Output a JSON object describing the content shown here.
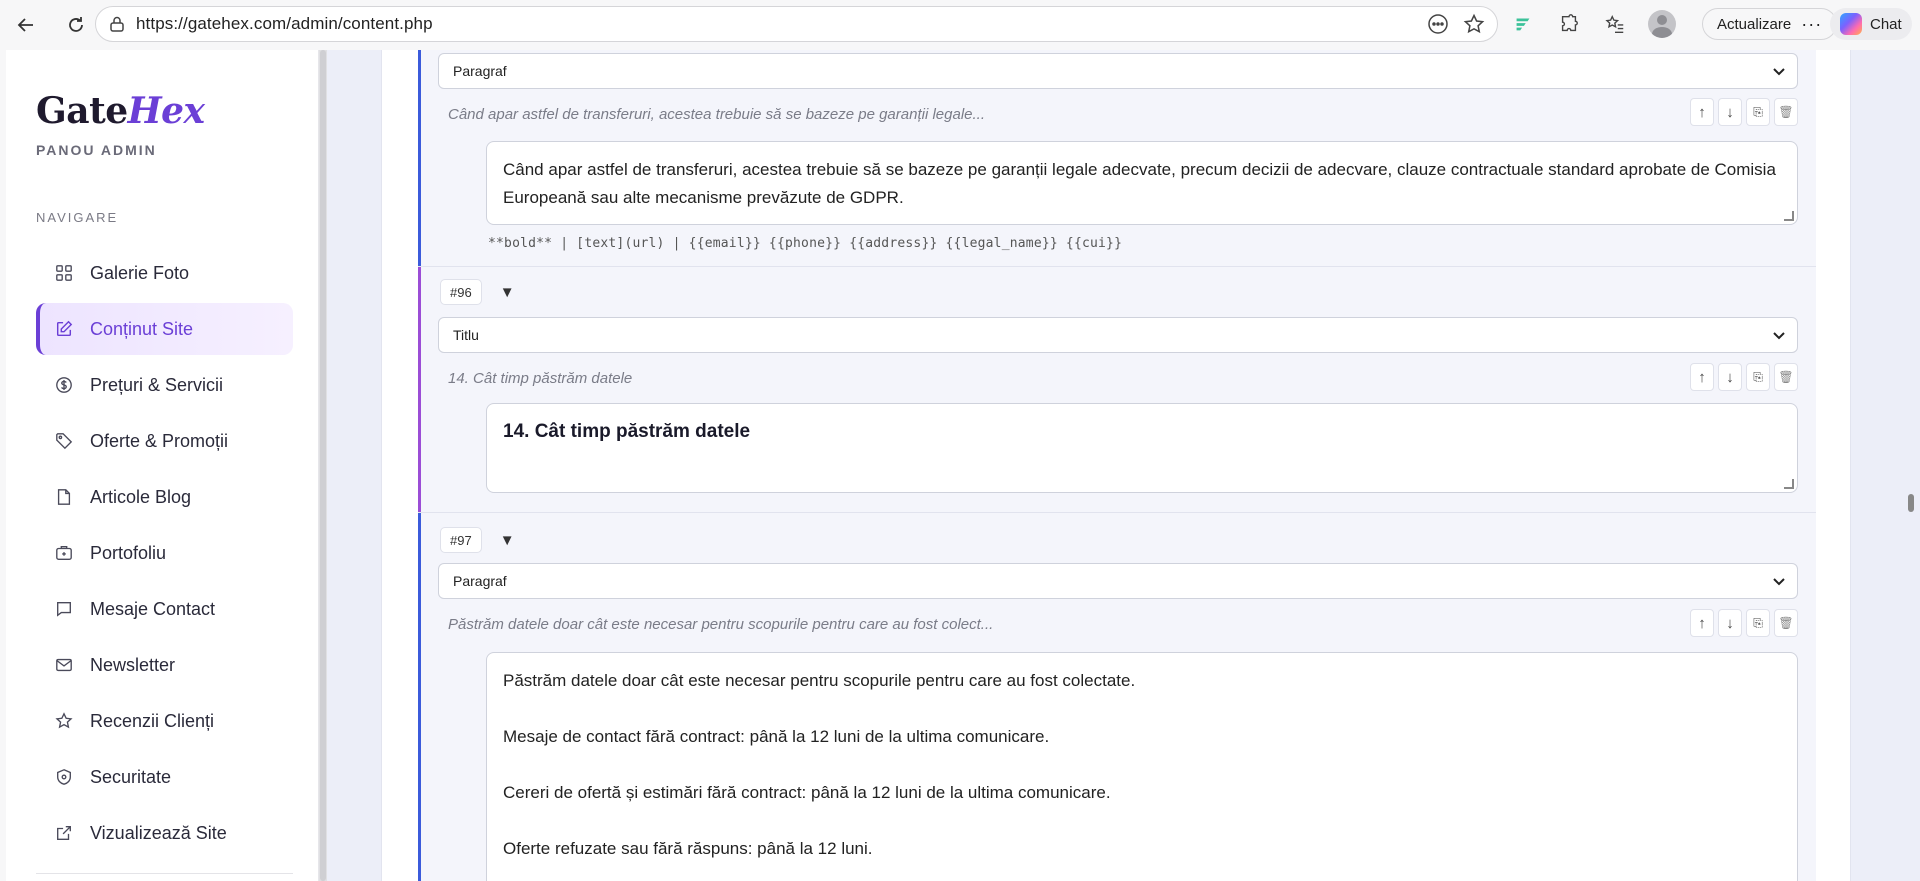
{
  "browser": {
    "url": "https://gatehex.com/admin/content.php",
    "update_label": "Actualizare",
    "chat_label": "Chat"
  },
  "sidebar": {
    "logo_part1": "Gate",
    "logo_part2": "Hex",
    "subtitle": "PANOU ADMIN",
    "nav_title": "NAVIGARE",
    "items": [
      {
        "label": "Galerie Foto",
        "icon": "grid-icon",
        "active": false
      },
      {
        "label": "Conținut Site",
        "icon": "edit-icon",
        "active": true
      },
      {
        "label": "Prețuri & Servicii",
        "icon": "dollar-icon",
        "active": false
      },
      {
        "label": "Oferte & Promoții",
        "icon": "tag-icon",
        "active": false
      },
      {
        "label": "Articole Blog",
        "icon": "document-icon",
        "active": false
      },
      {
        "label": "Portofoliu",
        "icon": "briefcase-icon",
        "active": false
      },
      {
        "label": "Mesaje Contact",
        "icon": "chat-bubble-icon",
        "active": false
      },
      {
        "label": "Newsletter",
        "icon": "mail-icon",
        "active": false
      },
      {
        "label": "Recenzii Clienți",
        "icon": "star-icon",
        "active": false
      },
      {
        "label": "Securitate",
        "icon": "shield-icon",
        "active": false
      },
      {
        "label": "Vizualizează Site",
        "icon": "external-link-icon",
        "active": false
      }
    ]
  },
  "blocks": [
    {
      "type_value": "Paragraf",
      "preview": "Când apar astfel de transferuri, acestea trebuie să se bazeze pe garanții legale...",
      "content": "Când apar astfel de transferuri, acestea trebuie să se bazeze pe garanții legale adecvate, precum decizii de adecvare, clauze contractuale standard aprobate de Comisia Europeană sau alte mecanisme prevăzute de GDPR.",
      "hint": "**bold**  |  [text](url)  |  {{email}} {{phone}} {{address}} {{legal_name}} {{cui}}"
    },
    {
      "id": "#96",
      "type_value": "Titlu",
      "preview": "14. Cât timp păstrăm datele",
      "content": "14. Cât timp păstrăm datele"
    },
    {
      "id": "#97",
      "type_value": "Paragraf",
      "preview": "Păstrăm datele doar cât este necesar pentru scopurile pentru care au fost colect...",
      "lines": [
        "Păstrăm datele doar cât este necesar pentru scopurile pentru care au fost colectate.",
        "Mesaje de contact fără contract: până la 12 luni de la ultima comunicare.",
        "Cereri de ofertă și estimări fără contract: până la 12 luni de la ultima comunicare.",
        "Oferte refuzate sau fără răspuns: până la 12 luni."
      ]
    }
  ],
  "tool_icons": [
    "arrow-up-icon",
    "arrow-down-icon",
    "copy-icon",
    "trash-icon"
  ],
  "colors": {
    "brand": "#6b3fd6",
    "accent_blue": "#3b5bdb",
    "accent_purple": "#9b4dd6"
  }
}
